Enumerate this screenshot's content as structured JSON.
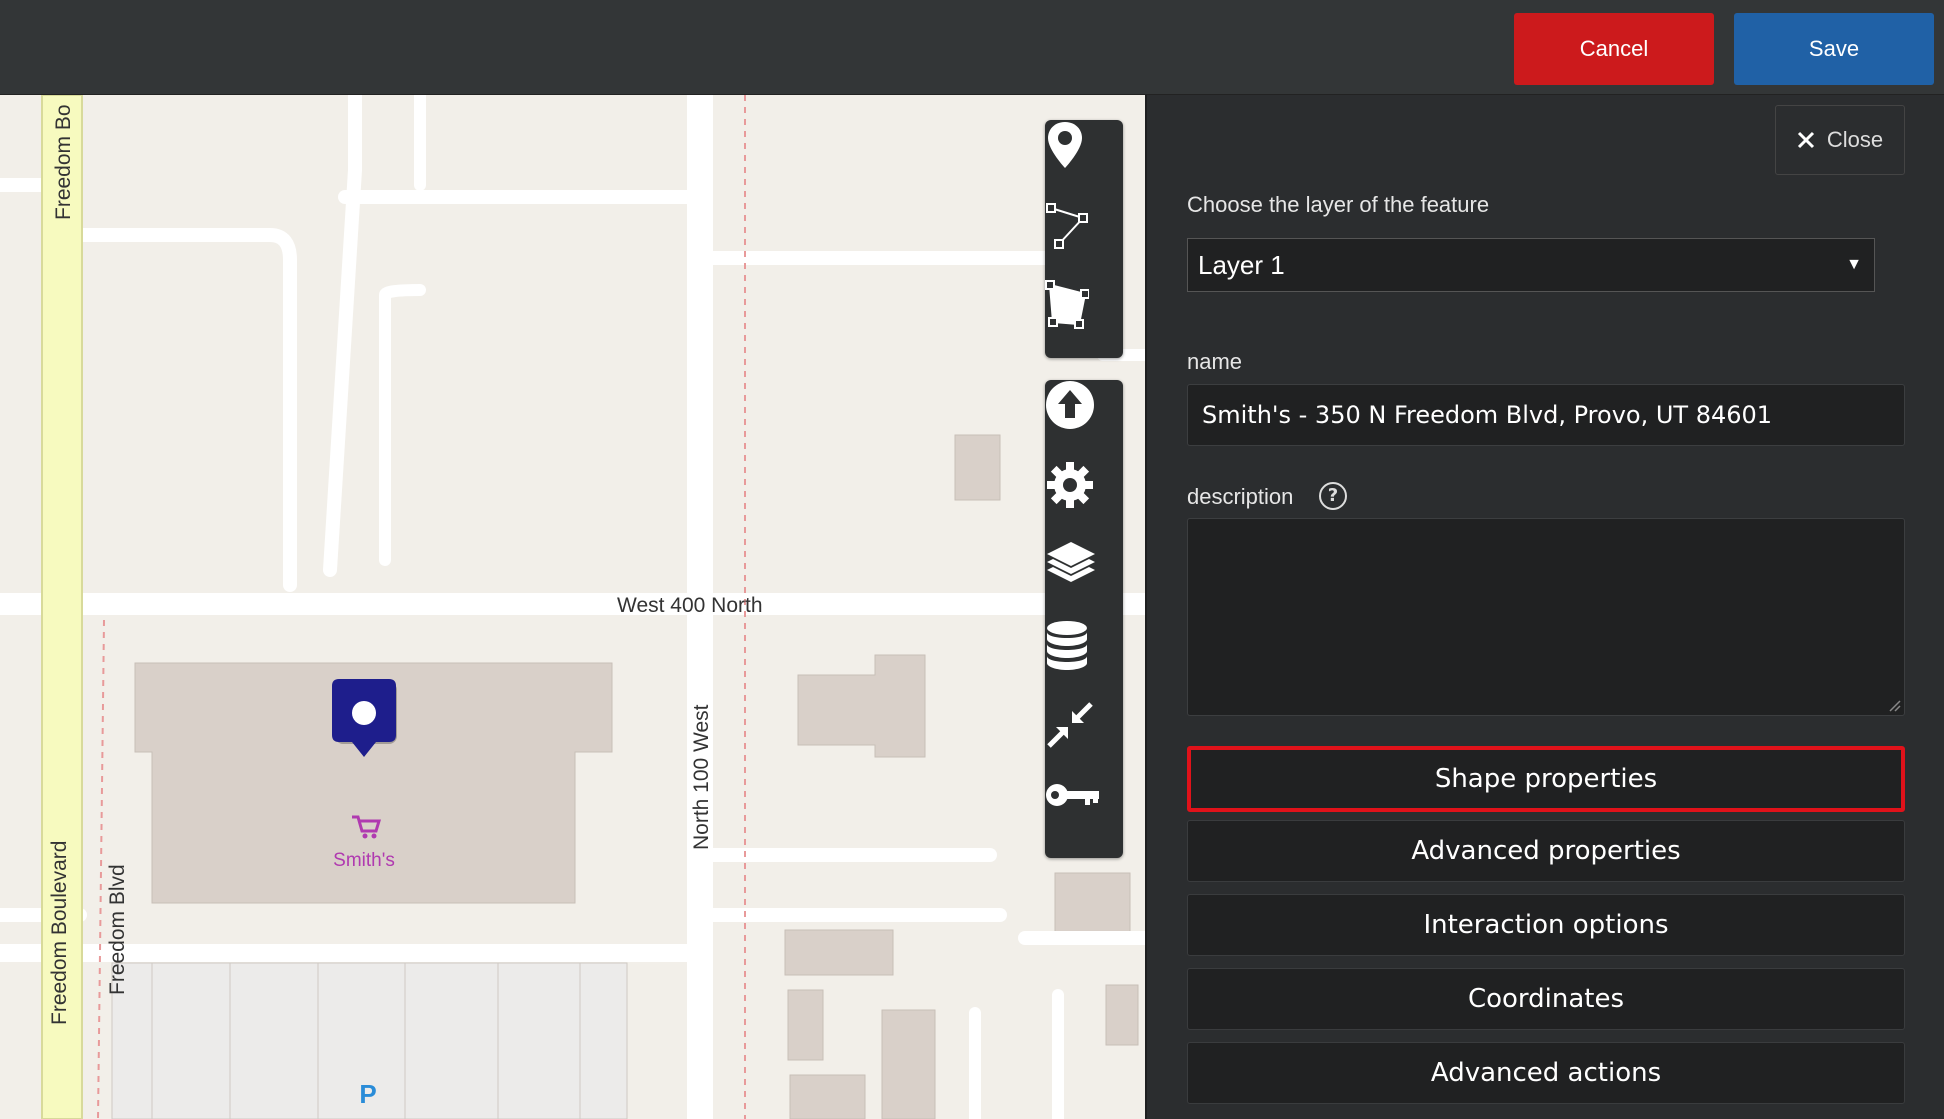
{
  "header": {
    "cancel_label": "Cancel",
    "save_label": "Save"
  },
  "map": {
    "streets": {
      "west_400_north": "West 400 North",
      "north_100_west": "North 100 West",
      "freedom_bo_top": "Freedom Bo",
      "freedom_boulevard": "Freedom Boulevard",
      "freedom_blvd": "Freedom Blvd"
    },
    "poi_label": "Smith's",
    "parking_label": "P",
    "colors": {
      "background": "#f2efe9",
      "road": "#ffffff",
      "primary_road": "#f7fabf",
      "building": "#d9d0c9",
      "marker": "#1e1e8c",
      "poi": "#b03ab0",
      "parking": "#2a8cd8"
    }
  },
  "toolbar": {
    "draw_tools": [
      "marker-icon",
      "polyline-icon",
      "polygon-icon"
    ],
    "action_tools": [
      "upload-icon",
      "gear-icon",
      "layers-icon",
      "database-icon",
      "collapse-icon",
      "key-icon"
    ]
  },
  "panel": {
    "close_label": "Close",
    "layer_prompt": "Choose the layer of the feature",
    "layer_value": "Layer 1",
    "name_label": "name",
    "name_value": "Smith's - 350 N Freedom Blvd, Provo, UT 84601",
    "description_label": "description",
    "description_value": "",
    "buttons": {
      "shape": "Shape properties",
      "advanced": "Advanced properties",
      "interaction": "Interaction options",
      "coordinates": "Coordinates",
      "actions": "Advanced actions"
    },
    "highlight_color": "#e0121a"
  }
}
